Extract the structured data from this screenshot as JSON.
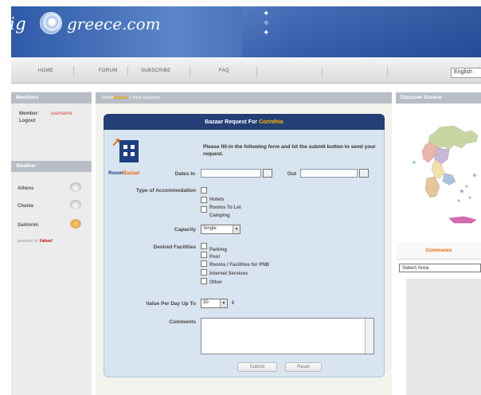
{
  "header": {
    "logo_prefix": "ig",
    "logo_suffix": "greece.com"
  },
  "nav": {
    "items": [
      "HOME",
      "FORUM",
      "SUBSCRIBE",
      "FAQ"
    ],
    "language": "English"
  },
  "members": {
    "title": "Members",
    "member_label": "Member:",
    "member_name": "username",
    "logout": "Logout"
  },
  "weather": {
    "title": "Weather",
    "cities": [
      {
        "name": "Athens",
        "icon": "cloud-icon"
      },
      {
        "name": "Chania",
        "icon": "cloud-icon"
      },
      {
        "name": "Santorini",
        "icon": "sun-icon"
      }
    ],
    "powered_by": "powered by",
    "provider": "Yahoo!"
  },
  "breadcrumb": {
    "part1": "Room",
    "part2": "Bazaar",
    "part3": "New Request"
  },
  "form": {
    "title_prefix": "Bazaar Request For",
    "title_place": "Corinthia",
    "brand_room": "Room",
    "brand_bazaar": "Bazaar",
    "intro": "Please fill-in the following form and hit the submit button to send your request.",
    "dates_in_label": "Dates In",
    "out_label": "Out",
    "accommodation_label": "Type of Accommodation",
    "accommodation_options": [
      "Hotels",
      "Rooms To Let",
      "Camping"
    ],
    "capacity_label": "Capacity",
    "capacity_value": "Single",
    "facilities_label": "Desired Facilities",
    "facilities_options": [
      "Parking",
      "Pool",
      "Rooms / Facilities for PNB",
      "Internet Services",
      "Other"
    ],
    "value_label": "Value Per Day Up To",
    "value_value": "30",
    "currency": "€",
    "comments_label": "Comments",
    "submit": "Submit",
    "reset": "Reset"
  },
  "right": {
    "discover_title": "Discover Greece",
    "communes_title": "Communes",
    "select_area": "Select Area"
  },
  "colors": {
    "header_blue": "#2e5aa8",
    "panel_title": "#233f75",
    "accent_orange": "#e8690c",
    "panel_bg": "#d8e4ef"
  }
}
